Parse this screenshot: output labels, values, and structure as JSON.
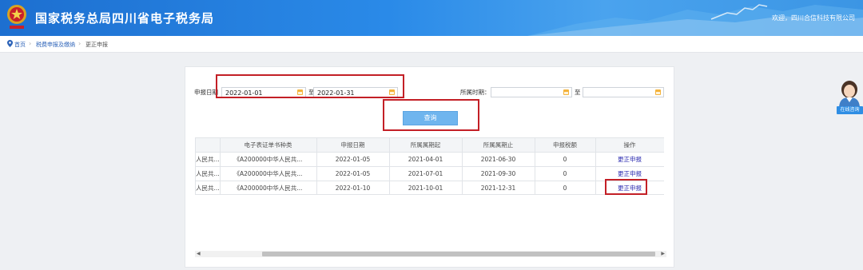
{
  "header": {
    "title": "国家税务总局四川省电子税务局",
    "welcome": "欢迎，四川合信科技有限公司"
  },
  "breadcrumb": {
    "home": "首页",
    "level1": "税费申报及缴纳",
    "current": "更正申报"
  },
  "filters": {
    "report_date_label": "申报日期",
    "report_date_from": "2022-01-01",
    "report_date_to_label": "至",
    "report_date_to": "2022-01-31",
    "period_label": "所属时期：",
    "period_from": "",
    "period_to_label": "至",
    "period_to": ""
  },
  "query_button": "查询",
  "table": {
    "headers": [
      "",
      "电子表证单书种类",
      "申报日期",
      "所属属期起",
      "所属属期止",
      "申报税额",
      "操作"
    ],
    "rows": [
      [
        "人民共...",
        "《A200000中华人民共...",
        "2022-01-05",
        "2021-04-01",
        "2021-06-30",
        "0",
        "更正申报"
      ],
      [
        "人民共...",
        "《A200000中华人民共...",
        "2022-01-05",
        "2021-07-01",
        "2021-09-30",
        "0",
        "更正申报"
      ],
      [
        "人民共...",
        "《A200000中华人民共...",
        "2022-01-10",
        "2021-10-01",
        "2021-12-31",
        "0",
        "更正申报"
      ]
    ]
  },
  "online_service": "在线咨询",
  "colors": {
    "header_blue": "#2a8ae8",
    "highlight_red": "#c31f26",
    "query_button": "#6fb5ee"
  }
}
